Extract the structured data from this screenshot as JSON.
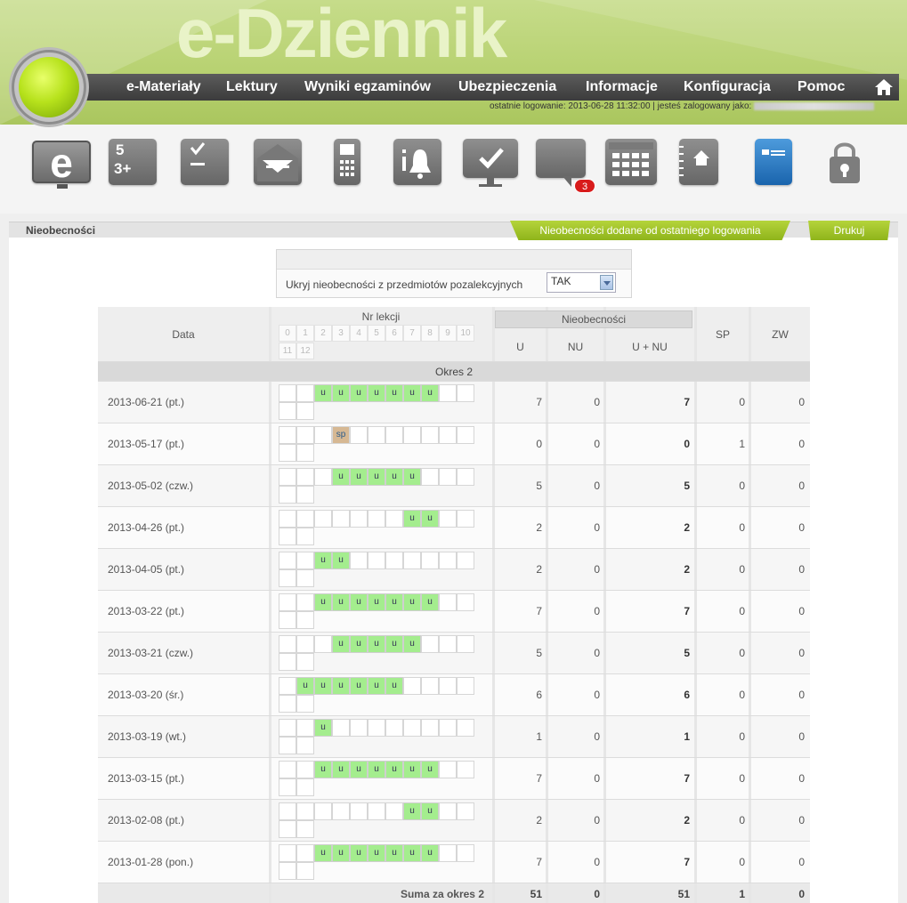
{
  "app": {
    "logo": "e-Dziennik"
  },
  "nav": [
    "e-Materiały",
    "Lektury",
    "Wyniki egzaminów",
    "Ubezpieczenia",
    "Informacje",
    "Konfiguracja",
    "Pomoc"
  ],
  "login": {
    "text": "ostatnie logowanie: 2013-06-28 11:32:00   |   jesteś zalogowany jako:"
  },
  "icons": [
    "e-icon",
    "grades-icon",
    "checklist-icon",
    "envelope-icon",
    "phone-icon",
    "notice-bell-icon",
    "screen-check-icon",
    "chat-icon",
    "calendar-icon",
    "notebook-icon",
    "card-icon",
    "lock-icon"
  ],
  "icon_tiles": {
    "e": "e",
    "grades_top": "5",
    "grades_bottom": "3+"
  },
  "messages_badge": "3",
  "panel": {
    "title": "Nieobecności",
    "tab_new": "Nieobecności dodane od ostatniego logowania",
    "tab_print": "Drukuj"
  },
  "filter": {
    "label": "Ukryj nieobecności z przedmiotów pozalekcyjnych",
    "selected": "TAK"
  },
  "table": {
    "col_date": "Data",
    "col_lessons": "Nr lekcji",
    "col_absences": "Nieobecności",
    "col_u": "U",
    "col_nu": "NU",
    "col_unu": "U + NU",
    "col_sp": "SP",
    "col_zw": "ZW",
    "lesson_numbers": [
      "0",
      "1",
      "2",
      "3",
      "4",
      "5",
      "6",
      "7",
      "8",
      "9",
      "10",
      "11",
      "12"
    ],
    "period": "Okres 2",
    "rows": [
      {
        "date": "2013-06-21 (pt.)",
        "lessons": [
          "",
          "",
          "u",
          "u",
          "u",
          "u",
          "u",
          "u",
          "u",
          "",
          "",
          "",
          ""
        ],
        "u": "7",
        "nu": "0",
        "unu": "7",
        "sp": "0",
        "zw": "0"
      },
      {
        "date": "2013-05-17 (pt.)",
        "lessons": [
          "",
          "",
          "",
          "sp",
          "",
          "",
          "",
          "",
          "",
          "",
          "",
          "",
          ""
        ],
        "u": "0",
        "nu": "0",
        "unu": "0",
        "sp": "1",
        "zw": "0"
      },
      {
        "date": "2013-05-02 (czw.)",
        "lessons": [
          "",
          "",
          "",
          "u",
          "u",
          "u",
          "u",
          "u",
          "",
          "",
          "",
          "",
          ""
        ],
        "u": "5",
        "nu": "0",
        "unu": "5",
        "sp": "0",
        "zw": "0"
      },
      {
        "date": "2013-04-26 (pt.)",
        "lessons": [
          "",
          "",
          "",
          "",
          "",
          "",
          "",
          "u",
          "u",
          "",
          "",
          "",
          ""
        ],
        "u": "2",
        "nu": "0",
        "unu": "2",
        "sp": "0",
        "zw": "0"
      },
      {
        "date": "2013-04-05 (pt.)",
        "lessons": [
          "",
          "",
          "u",
          "u",
          "",
          "",
          "",
          "",
          "",
          "",
          "",
          "",
          ""
        ],
        "u": "2",
        "nu": "0",
        "unu": "2",
        "sp": "0",
        "zw": "0"
      },
      {
        "date": "2013-03-22 (pt.)",
        "lessons": [
          "",
          "",
          "u",
          "u",
          "u",
          "u",
          "u",
          "u",
          "u",
          "",
          "",
          "",
          ""
        ],
        "u": "7",
        "nu": "0",
        "unu": "7",
        "sp": "0",
        "zw": "0"
      },
      {
        "date": "2013-03-21 (czw.)",
        "lessons": [
          "",
          "",
          "",
          "u",
          "u",
          "u",
          "u",
          "u",
          "",
          "",
          "",
          "",
          ""
        ],
        "u": "5",
        "nu": "0",
        "unu": "5",
        "sp": "0",
        "zw": "0"
      },
      {
        "date": "2013-03-20 (śr.)",
        "lessons": [
          "",
          "u",
          "u",
          "u",
          "u",
          "u",
          "u",
          "",
          "",
          "",
          "",
          "",
          ""
        ],
        "u": "6",
        "nu": "0",
        "unu": "6",
        "sp": "0",
        "zw": "0"
      },
      {
        "date": "2013-03-19 (wt.)",
        "lessons": [
          "",
          "",
          "u",
          "",
          "",
          "",
          "",
          "",
          "",
          "",
          "",
          "",
          ""
        ],
        "u": "1",
        "nu": "0",
        "unu": "1",
        "sp": "0",
        "zw": "0"
      },
      {
        "date": "2013-03-15 (pt.)",
        "lessons": [
          "",
          "",
          "u",
          "u",
          "u",
          "u",
          "u",
          "u",
          "u",
          "",
          "",
          "",
          ""
        ],
        "u": "7",
        "nu": "0",
        "unu": "7",
        "sp": "0",
        "zw": "0"
      },
      {
        "date": "2013-02-08 (pt.)",
        "lessons": [
          "",
          "",
          "",
          "",
          "",
          "",
          "",
          "u",
          "u",
          "",
          "",
          "",
          ""
        ],
        "u": "2",
        "nu": "0",
        "unu": "2",
        "sp": "0",
        "zw": "0"
      },
      {
        "date": "2013-01-28 (pon.)",
        "lessons": [
          "",
          "",
          "u",
          "u",
          "u",
          "u",
          "u",
          "u",
          "u",
          "",
          "",
          "",
          ""
        ],
        "u": "7",
        "nu": "0",
        "unu": "7",
        "sp": "0",
        "zw": "0"
      }
    ],
    "sum": {
      "label": "Suma za okres 2",
      "u": "51",
      "nu": "0",
      "unu": "51",
      "sp": "1",
      "zw": "0"
    }
  },
  "colors": {
    "accent_green": "#9cc21f",
    "absence_green": "#a4ed8e",
    "sp_brown": "#d6b893",
    "nav_dark": "#4a4a4a"
  }
}
